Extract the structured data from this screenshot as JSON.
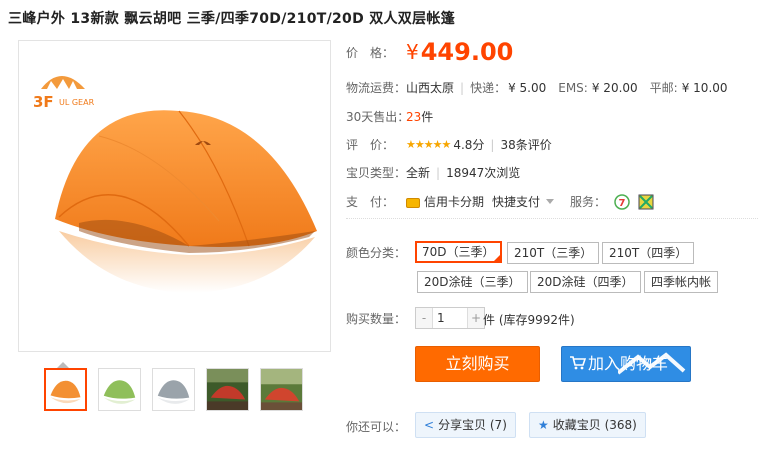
{
  "product": {
    "title": "三峰户外 13新款 飘云胡吧 三季/四季70D/210T/20D 双人双层帐篷",
    "brand_logo_text": "3F",
    "brand_logo_sub": "UL GEAR"
  },
  "price": {
    "label": "价　格：",
    "symbol": "¥",
    "value": "449.00"
  },
  "shipping": {
    "label": "物流运费：",
    "origin": "山西太原",
    "express_label": "快递：",
    "express": "¥ 5.00",
    "ems_label": "EMS:",
    "ems": "¥ 20.00",
    "mail_label": "平邮:",
    "mail": "¥ 10.00"
  },
  "sales": {
    "label": "30天售出：",
    "count": "23",
    "unit": "件"
  },
  "rating": {
    "label": "评　价：",
    "stars": "★★★★★",
    "score": "4.8分",
    "reviews": "38条评价"
  },
  "item_type": {
    "label": "宝贝类型：",
    "condition": "全新",
    "views": "18947次浏览"
  },
  "payment": {
    "label": "支　付：",
    "credit": "信用卡分期",
    "quick": "快捷支付",
    "service_label": "服务："
  },
  "color": {
    "label": "颜色分类：",
    "options": [
      "70D（三季）",
      "210T（三季）",
      "210T（四季）",
      "20D涂硅（三季）",
      "20D涂硅（四季）",
      "四季帐内帐"
    ],
    "selected_index": 0,
    "check": "✓"
  },
  "quantity": {
    "label": "购买数量：",
    "value": "1",
    "minus": "-",
    "plus": "+",
    "stock": "件 (库存9992件)"
  },
  "actions": {
    "buy": "立刻购买",
    "cart": "加入购物车"
  },
  "share": {
    "label": "你还可以：",
    "share_btn": "分享宝贝 (7)",
    "fav_btn": "收藏宝贝 (368)"
  },
  "colors": {
    "accent": "#ff4400",
    "buy": "#ff6a00",
    "cart": "#2f8de4"
  }
}
